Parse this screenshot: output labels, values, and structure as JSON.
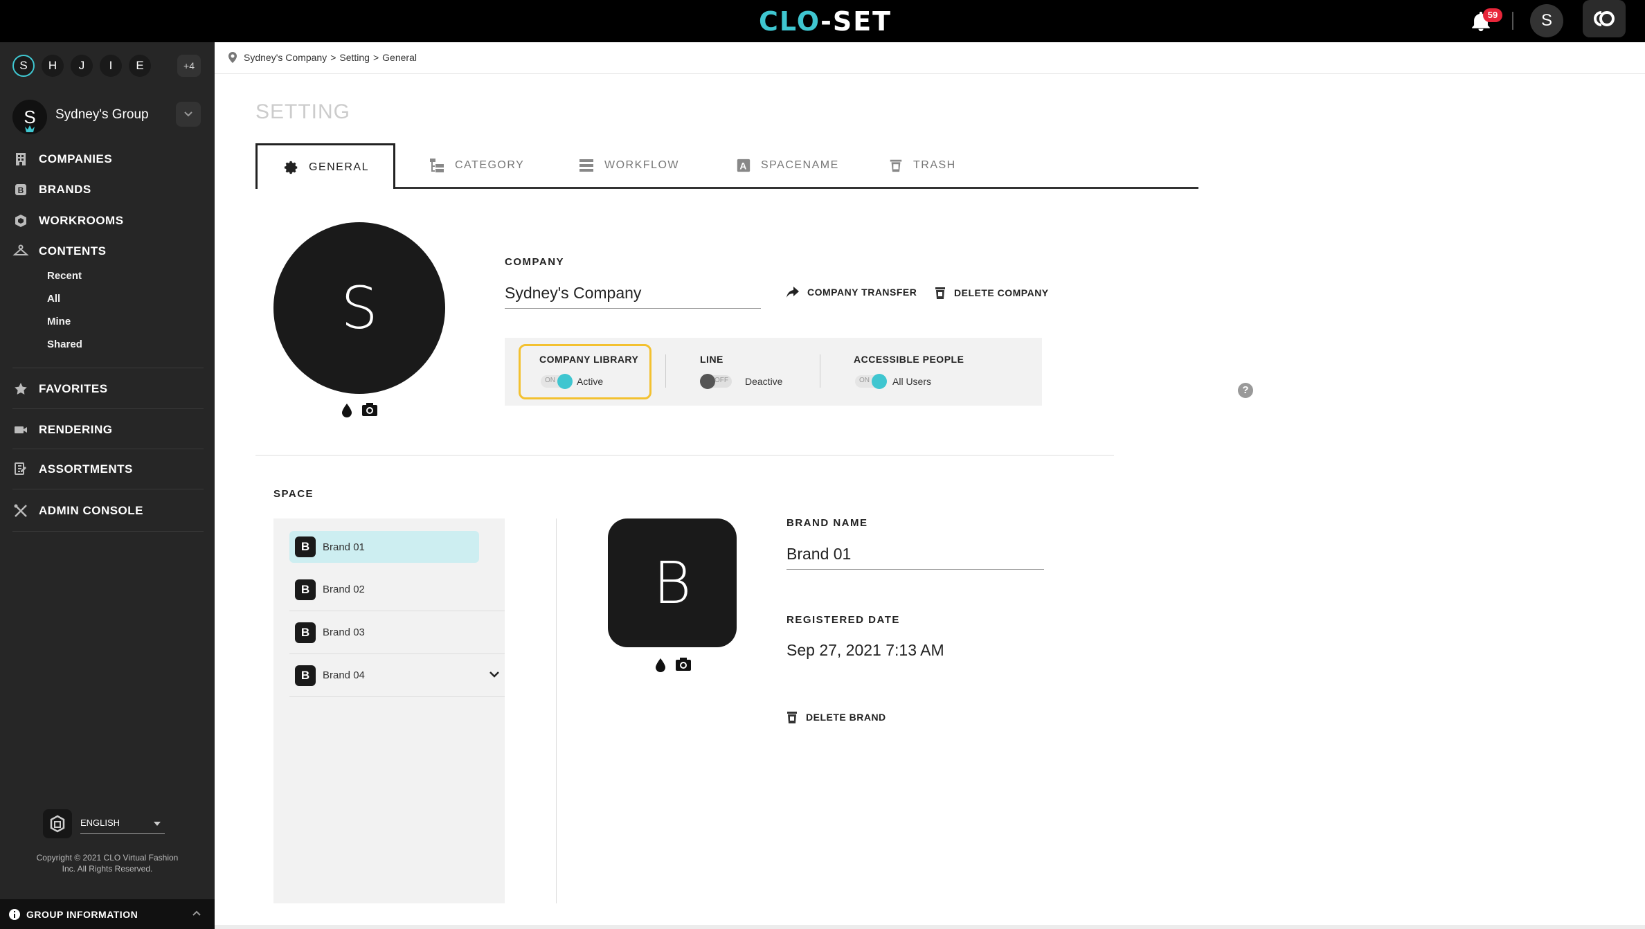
{
  "topbar": {
    "logo_left": "CLO",
    "logo_right": "-SET",
    "notification_count": "59",
    "user_initial": "S"
  },
  "sidebar": {
    "groups": [
      "S",
      "H",
      "J",
      "I",
      "E"
    ],
    "more_groups": "+4",
    "group_initial": "S",
    "group_name": "Sydney's Group",
    "nav": {
      "companies": "COMPANIES",
      "brands": "BRANDS",
      "workrooms": "WORKROOMS",
      "contents": "CONTENTS",
      "favorites": "FAVORITES",
      "rendering": "RENDERING",
      "assortments": "ASSORTMENTS",
      "admin_console": "ADMIN CONSOLE"
    },
    "contents_sub": [
      "Recent",
      "All",
      "Mine",
      "Shared"
    ],
    "language": "ENGLISH",
    "copyright_line1": "Copyright © 2021 CLO Virtual Fashion",
    "copyright_line2": "Inc. All Rights Reserved.",
    "group_information": "GROUP INFORMATION"
  },
  "breadcrumb": {
    "company": "Sydney's Company",
    "sep": ">",
    "setting": "Setting",
    "general": "General"
  },
  "page_title": "SETTING",
  "tabs": [
    {
      "label": "GENERAL",
      "active": true
    },
    {
      "label": "CATEGORY"
    },
    {
      "label": "WORKFLOW"
    },
    {
      "label": "SPACENAME"
    },
    {
      "label": "TRASH"
    }
  ],
  "company": {
    "initial": "S",
    "label": "COMPANY",
    "name": "Sydney's Company",
    "transfer": "COMPANY TRANSFER",
    "delete": "DELETE COMPANY",
    "settings": {
      "library": {
        "label": "COMPANY LIBRARY",
        "toggle": "ON",
        "value": "Active"
      },
      "line": {
        "label": "LINE",
        "toggle": "OFF",
        "value": "Deactive"
      },
      "accessible": {
        "label": "ACCESSIBLE PEOPLE",
        "toggle": "ON",
        "value": "All Users"
      }
    },
    "help": "?"
  },
  "space": {
    "label": "SPACE",
    "brands": [
      {
        "initial": "B",
        "name": "Brand 01"
      },
      {
        "initial": "B",
        "name": "Brand 02"
      },
      {
        "initial": "B",
        "name": "Brand 03"
      },
      {
        "initial": "B",
        "name": "Brand 04"
      }
    ],
    "selected_index": 0
  },
  "brand_detail": {
    "initial": "B",
    "name_label": "BRAND NAME",
    "name": "Brand 01",
    "date_label": "REGISTERED DATE",
    "date": "Sep 27, 2021 7:13 AM",
    "delete": "DELETE BRAND"
  },
  "colors": {
    "accent": "#3fc6d0",
    "highlight": "#f3c130",
    "badge": "#e8263a",
    "sidebar": "#262626"
  }
}
